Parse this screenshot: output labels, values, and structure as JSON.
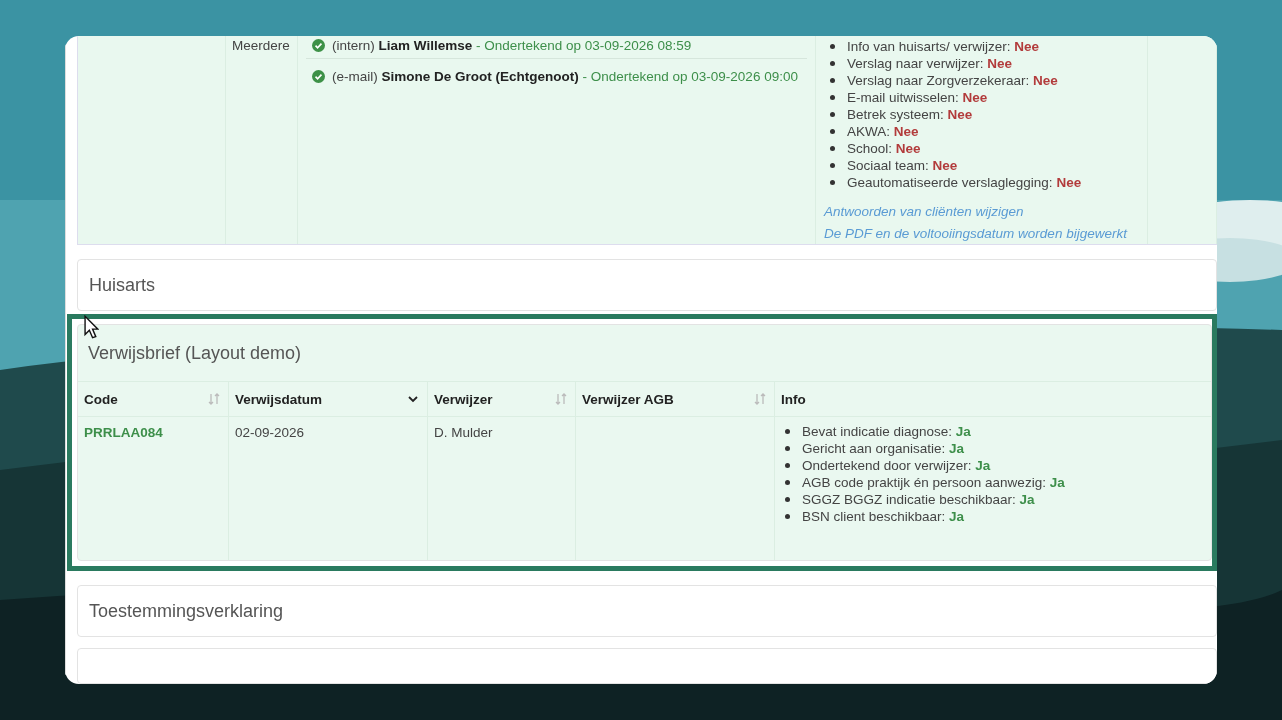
{
  "top_row": {
    "column_2": "Meerdere",
    "signatures": [
      {
        "channel": "(intern)",
        "name": "Liam Willemse",
        "status": "- Ondertekend op 03-09-2026 08:59",
        "signed": true
      },
      {
        "channel": "(e-mail)",
        "name": "Simone De Groot (Echtgenoot)",
        "status": "- Ondertekend op 03-09-2026 09:00",
        "signed": true
      }
    ],
    "info": [
      {
        "label": "Info van huisarts/ verwijzer:",
        "value": "Nee",
        "positive": false
      },
      {
        "label": "Verslag naar verwijzer:",
        "value": "Nee",
        "positive": false
      },
      {
        "label": "Verslag naar Zorgverzekeraar:",
        "value": "Nee",
        "positive": false
      },
      {
        "label": "E-mail uitwisselen:",
        "value": "Nee",
        "positive": false
      },
      {
        "label": "Betrek systeem:",
        "value": "Nee",
        "positive": false
      },
      {
        "label": "AKWA:",
        "value": "Nee",
        "positive": false
      },
      {
        "label": "School:",
        "value": "Nee",
        "positive": false
      },
      {
        "label": "Sociaal team:",
        "value": "Nee",
        "positive": false
      },
      {
        "label": "Geautomatiseerde verslaglegging:",
        "value": "Nee",
        "positive": false
      }
    ],
    "links": [
      "Antwoorden van cliënten wijzigen",
      "De PDF en de voltooiingsdatum worden bijgewerkt"
    ]
  },
  "panels": [
    {
      "title": "Huisarts",
      "highlighted": false
    },
    {
      "title": "Verwijsbrief (Layout demo)",
      "highlighted": true,
      "table": {
        "columns": [
          {
            "label": "Code",
            "kind": "sortable"
          },
          {
            "label": "Verwijsdatum",
            "kind": "sorted"
          },
          {
            "label": "Verwijzer",
            "kind": "sortable"
          },
          {
            "label": "Verwijzer AGB",
            "kind": "sortable"
          },
          {
            "label": "Info",
            "kind": "plain"
          }
        ],
        "rows": [
          {
            "code": "PRRLAA084",
            "date": "02-09-2026",
            "referrer": "D. Mulder",
            "info": [
              {
                "label": "Bevat indicatie diagnose:",
                "value": "Ja",
                "positive": true
              },
              {
                "label": "Gericht aan organisatie:",
                "value": "Ja",
                "positive": true
              },
              {
                "label": "Ondertekend door verwijzer:",
                "value": "Ja",
                "positive": true
              },
              {
                "label": "AGB code praktijk én persoon aanwezig:",
                "value": "Ja",
                "positive": true
              },
              {
                "label": "SGGZ BGGZ indicatie beschikbaar:",
                "value": "Ja",
                "positive": true
              },
              {
                "label": "BSN client beschikbaar:",
                "value": "Ja",
                "positive": true
              }
            ]
          }
        ]
      }
    },
    {
      "title": "Toestemmingsverklaring",
      "highlighted": false
    }
  ]
}
